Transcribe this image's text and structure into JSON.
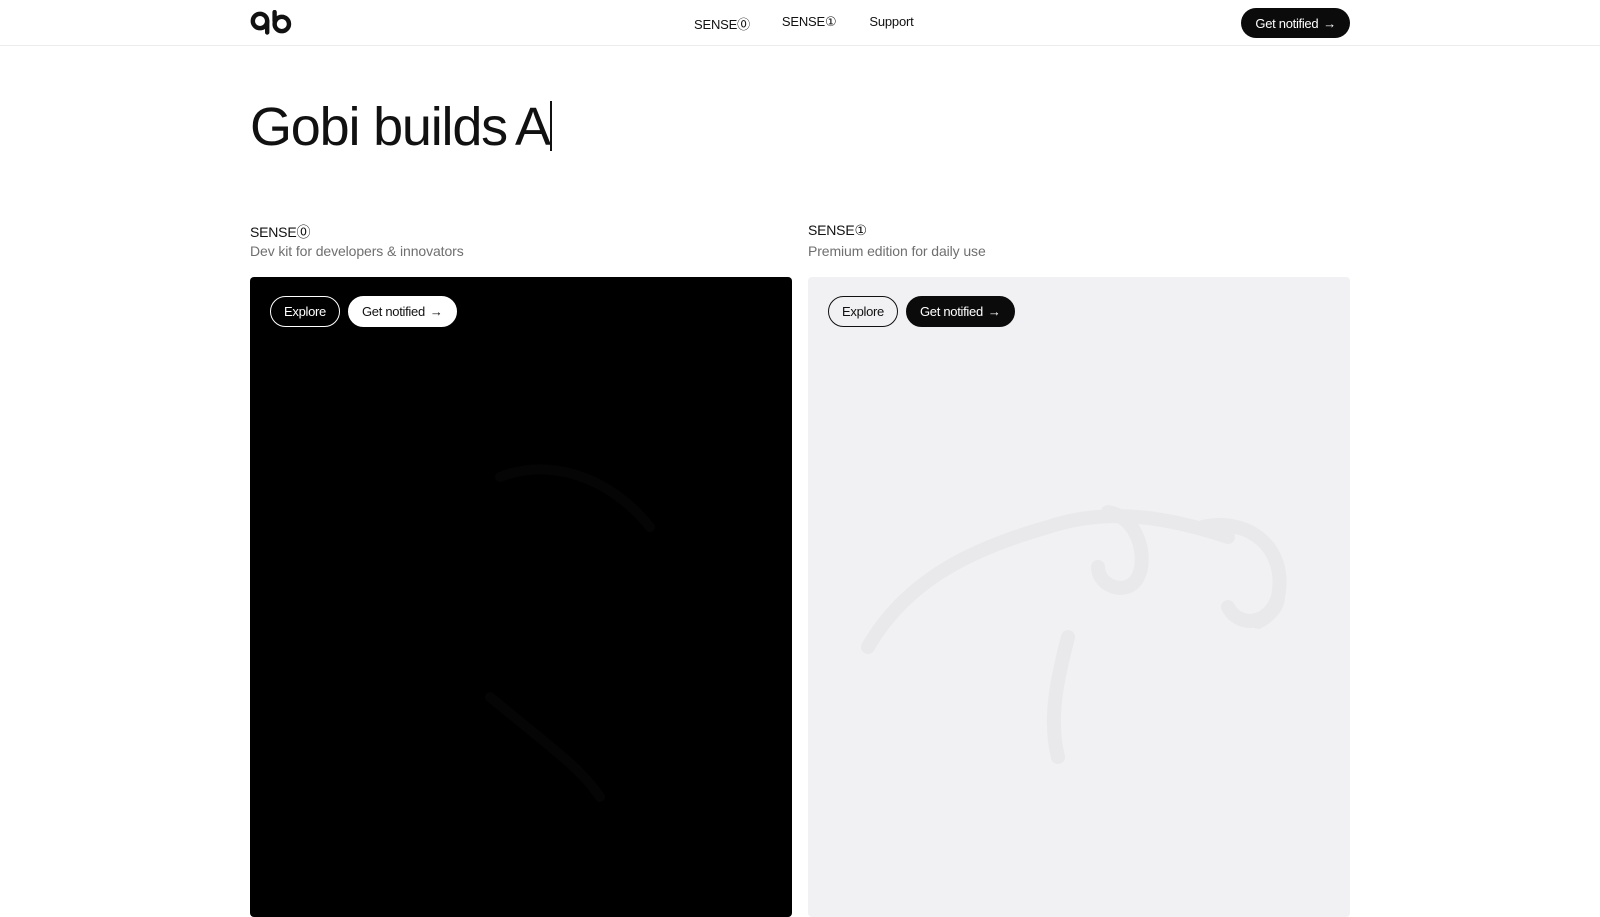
{
  "header": {
    "logo_icon": "gobi-logo-icon",
    "nav": [
      {
        "label": "SENSE⓪"
      },
      {
        "label": "SENSE①"
      },
      {
        "label": "Support"
      }
    ],
    "cta_label": "Get notified",
    "cta_icon": "arrow-right-icon"
  },
  "hero": {
    "text": "Gobi builds",
    "typed": "A"
  },
  "products": [
    {
      "name": "SENSE⓪",
      "description": "Dev kit for developers & innovators",
      "explore_label": "Explore",
      "notify_label": "Get notified",
      "theme": "dark"
    },
    {
      "name": "SENSE①",
      "description": "Premium edition for daily use",
      "explore_label": "Explore",
      "notify_label": "Get notified",
      "theme": "light"
    }
  ],
  "colors": {
    "dark_card": "#000000",
    "light_card": "#f1f1f3",
    "text_primary": "#111111",
    "text_muted": "#6f6f6f"
  }
}
